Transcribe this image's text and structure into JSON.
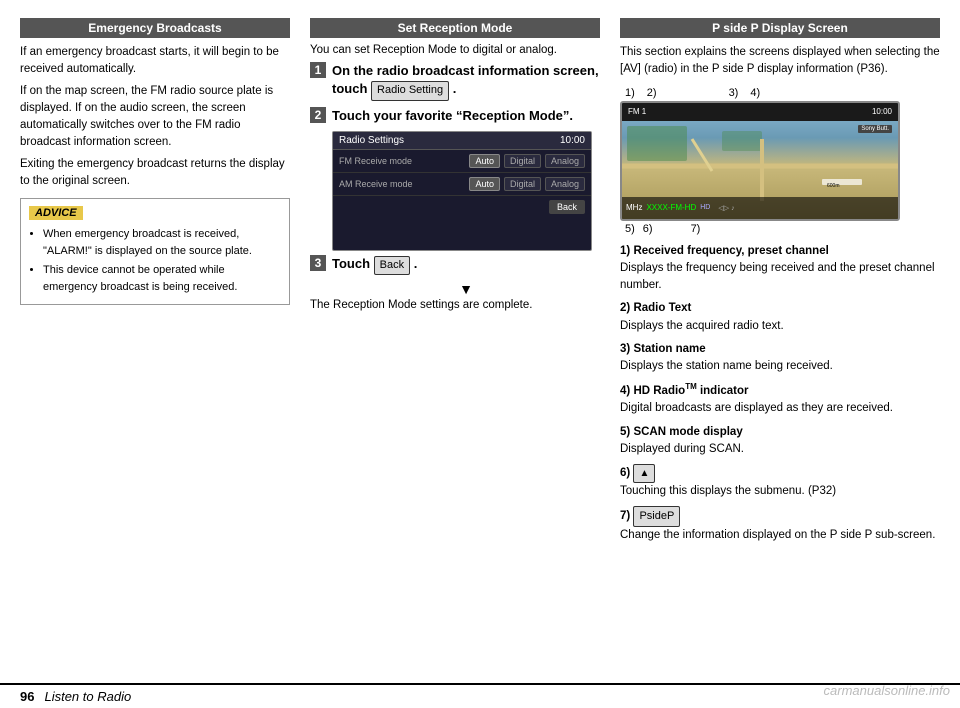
{
  "page": {
    "number": "96",
    "footer_title": "Listen to Radio"
  },
  "left_section": {
    "header": "Emergency Broadcasts",
    "paragraphs": [
      "If an emergency broadcast starts, it will begin to be received automatically.",
      "If on the map screen, the FM radio source plate is displayed. If on the audio screen, the screen automatically switches over to the FM radio broadcast information screen.",
      "Exiting the emergency broadcast returns the display to the original screen."
    ],
    "advice": {
      "header": "ADVICE",
      "items": [
        "When emergency broadcast is received, \"ALARM!\" is displayed on the source plate.",
        "This device cannot be operated while emergency broadcast is being received."
      ]
    }
  },
  "mid_section": {
    "header": "Set Reception Mode",
    "intro": "You can set Reception Mode to digital or analog.",
    "steps": [
      {
        "num": "1",
        "text_bold": "On the radio broadcast information screen, touch",
        "btn": "Radio Setting",
        "text_after": "."
      },
      {
        "num": "2",
        "text_bold": "Touch your favorite “Reception Mode”."
      },
      {
        "num": "3",
        "text_before": "Touch ",
        "btn": "Back",
        "text_after": "."
      }
    ],
    "radio_settings": {
      "title": "Radio Settings",
      "time": "10:00",
      "rows": [
        {
          "label": "FM Receive mode",
          "options": [
            "Auto",
            "Digital",
            "Analog"
          ],
          "active": 0
        },
        {
          "label": "AM Receive mode",
          "options": [
            "Auto",
            "Digital",
            "Analog"
          ],
          "active": 0
        }
      ],
      "back_btn": "Back"
    },
    "complete_text": "The Reception Mode settings are complete."
  },
  "right_section": {
    "header": "P side P Display Screen",
    "description": "This section explains the screens displayed when selecting the [AV] (radio) in the P side P display information (P36).",
    "labels_top": [
      "1)",
      "2)",
      "3)",
      "4)"
    ],
    "labels_bottom": [
      "5)",
      "6)",
      "7)"
    ],
    "nav_screen": {
      "fm_label": "FM 1",
      "time": "10:00",
      "freq": "MHz",
      "station": "XXXX-FM-HD",
      "hd_label": "HD",
      "scale": "600m",
      "hint_btn": "Sony Butt."
    },
    "items": [
      {
        "num": "1)",
        "title": "Received frequency, preset channel",
        "desc": "Displays the frequency being received and the preset channel number."
      },
      {
        "num": "2)",
        "title": "Radio Text",
        "desc": "Displays the acquired radio text."
      },
      {
        "num": "3)",
        "title": "Station name",
        "desc": "Displays the station name being received."
      },
      {
        "num": "4)",
        "title": "HD Radio",
        "title_tm": "TM",
        "title_bold2": " indicator",
        "desc": "Digital broadcasts are displayed as they are received."
      },
      {
        "num": "5)",
        "title": "SCAN mode display",
        "desc": "Displayed during SCAN."
      },
      {
        "num": "6)",
        "btn_triangle": "▲",
        "desc": "Touching this displays the submenu. (P32)"
      },
      {
        "num": "7)",
        "btn_psidep": "PsideP",
        "desc": "Change the information displayed on the P side P sub-screen."
      }
    ]
  },
  "watermark": "carmanualsonline.info"
}
